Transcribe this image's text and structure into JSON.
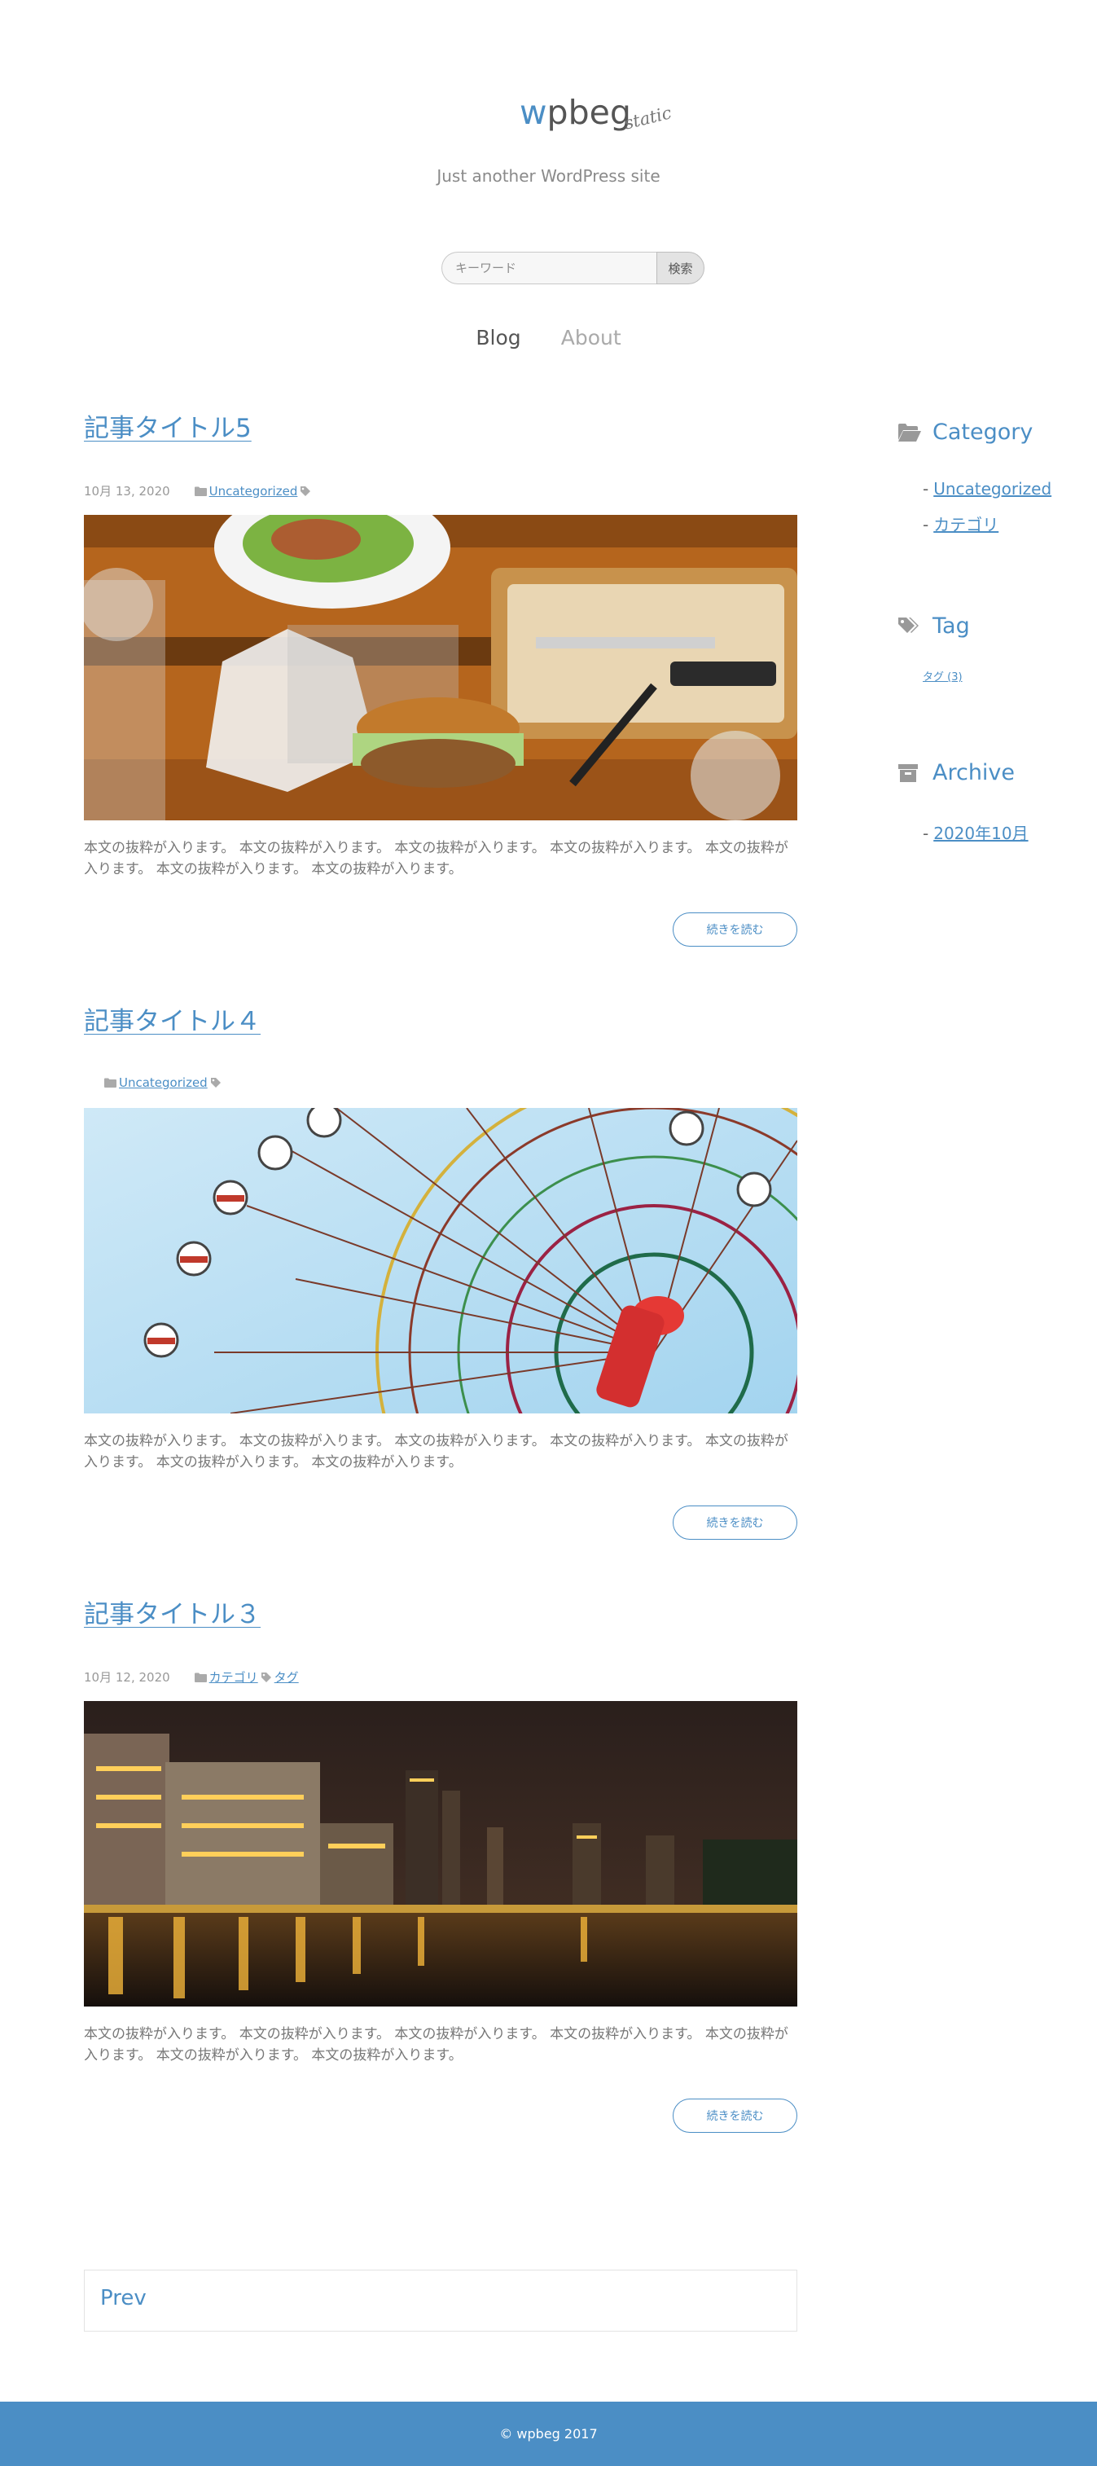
{
  "site": {
    "logo_accent": "w",
    "logo_rest": "pbeg",
    "logo_sub": "static",
    "tagline": "Just another WordPress site"
  },
  "search": {
    "placeholder": "キーワード",
    "button": "検索"
  },
  "nav": {
    "items": [
      {
        "label": "Blog",
        "active": true
      },
      {
        "label": "About",
        "active": false
      }
    ]
  },
  "posts": [
    {
      "title": "記事タイトル5",
      "date": "10月 13, 2020",
      "categories": [
        "Uncategorized"
      ],
      "tags": [],
      "excerpt": "本文の抜粋が入ります。 本文の抜粋が入ります。 本文の抜粋が入ります。 本文の抜粋が入ります。 本文の抜粋が入ります。 本文の抜粋が入ります。 本文の抜粋が入ります。",
      "more": "続きを読む",
      "image": "burger-food-photo"
    },
    {
      "title": "記事タイトル４",
      "date": "",
      "categories": [
        "Uncategorized"
      ],
      "tags": [],
      "excerpt": "本文の抜粋が入ります。 本文の抜粋が入ります。 本文の抜粋が入ります。 本文の抜粋が入ります。 本文の抜粋が入ります。 本文の抜粋が入ります。 本文の抜粋が入ります。",
      "more": "続きを読む",
      "image": "ferris-wheel-photo"
    },
    {
      "title": "記事タイトル３",
      "date": "10月 12, 2020",
      "categories": [
        "カテゴリ"
      ],
      "tags": [
        "タグ"
      ],
      "excerpt": "本文の抜粋が入ります。 本文の抜粋が入ります。 本文の抜粋が入ります。 本文の抜粋が入ります。 本文の抜粋が入ります。 本文の抜粋が入ります。 本文の抜粋が入ります。",
      "more": "続きを読む",
      "image": "night-city-photo"
    }
  ],
  "pagination": {
    "prev": "Prev"
  },
  "sidebar": {
    "category": {
      "title": "Category",
      "icon": "folder-open-icon",
      "bullet": "-",
      "items": [
        "Uncategorized",
        "カテゴリ"
      ]
    },
    "tag": {
      "title": "Tag",
      "icon": "tags-icon",
      "items": [
        "タグ (3)"
      ]
    },
    "archive": {
      "title": "Archive",
      "icon": "archive-icon",
      "bullet": "-",
      "items": [
        "2020年10月"
      ]
    }
  },
  "footer": {
    "text": "© wpbeg 2017"
  },
  "colors": {
    "accent": "#4b8ec5",
    "text": "#666666",
    "muted": "#999999"
  }
}
